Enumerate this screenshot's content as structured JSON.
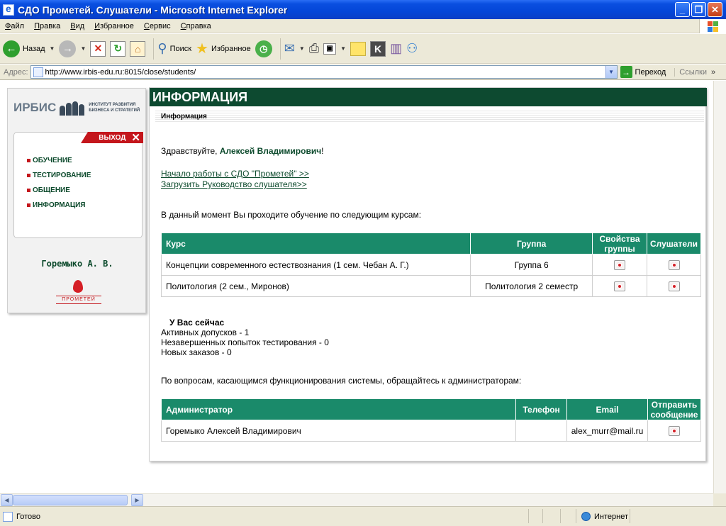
{
  "window": {
    "title": "СДО Прометей. Слушатели - Microsoft Internet Explorer",
    "minimize_glyph": "_",
    "maximize_glyph": "❐",
    "close_glyph": "✕"
  },
  "menu": [
    "Файл",
    "Правка",
    "Вид",
    "Избранное",
    "Сервис",
    "Справка"
  ],
  "toolbar": {
    "back": "Назад",
    "search": "Поиск",
    "favorites": "Избранное"
  },
  "address": {
    "label": "Адрес:",
    "url": "http://www.irbis-edu.ru:8015/close/students/",
    "go": "Переход",
    "links": "Ссылки"
  },
  "status": {
    "text": "Готово",
    "zone": "Интернет"
  },
  "sidebar": {
    "brand": "ИРБИС",
    "institute_line1": "ИНСТИТУТ РАЗВИТИЯ",
    "institute_line2": "БИЗНЕСА И СТРАТЕГИЙ",
    "exit": "ВЫХОД",
    "nav": [
      "ОБУЧЕНИЕ",
      "ТЕСТИРОВАНИЕ",
      "ОБЩЕНИЕ",
      "ИНФОРМАЦИЯ"
    ],
    "user": "Горемыко А. В.",
    "partner_logo_text": "ПРОМЕТЕЙ"
  },
  "main": {
    "header": "ИНФОРМАЦИЯ",
    "subheader": "Информация",
    "greeting_prefix": "Здравствуйте, ",
    "greeting_name": "Алексей Владимирович",
    "greeting_suffix": "!",
    "link_start": "Начало работы с СДО \"Прометей\" >>",
    "link_guide": "Загрузить Руководство слушателя>>",
    "courses_intro": "В данный момент Вы проходите обучение по следующим курсам:",
    "courses_table": {
      "headers": [
        "Курс",
        "Группа",
        "Свойства группы",
        "Слушатели"
      ],
      "rows": [
        {
          "course": "Концепции современного естествознания (1 сем. Чебан А. Г.)",
          "group": "Группа 6"
        },
        {
          "course": "Политология (2 сем., Миронов)",
          "group": "Политология 2 семестр"
        }
      ]
    },
    "now_title": "У Вас сейчас",
    "now_lines": [
      "Активных допусков - 1",
      "Незавершенных попыток тестирования - 0",
      "Новых заказов - 0"
    ],
    "admins_intro": "По вопросам, касающимся функционирования системы, обращайтесь к администраторам:",
    "admins_table": {
      "headers": [
        "Администратор",
        "Телефон",
        "Email",
        "Отправить сообщение"
      ],
      "rows": [
        {
          "name": "Горемыко Алексей Владимирович",
          "phone": "",
          "email": "alex_murr@mail.ru"
        }
      ]
    }
  }
}
